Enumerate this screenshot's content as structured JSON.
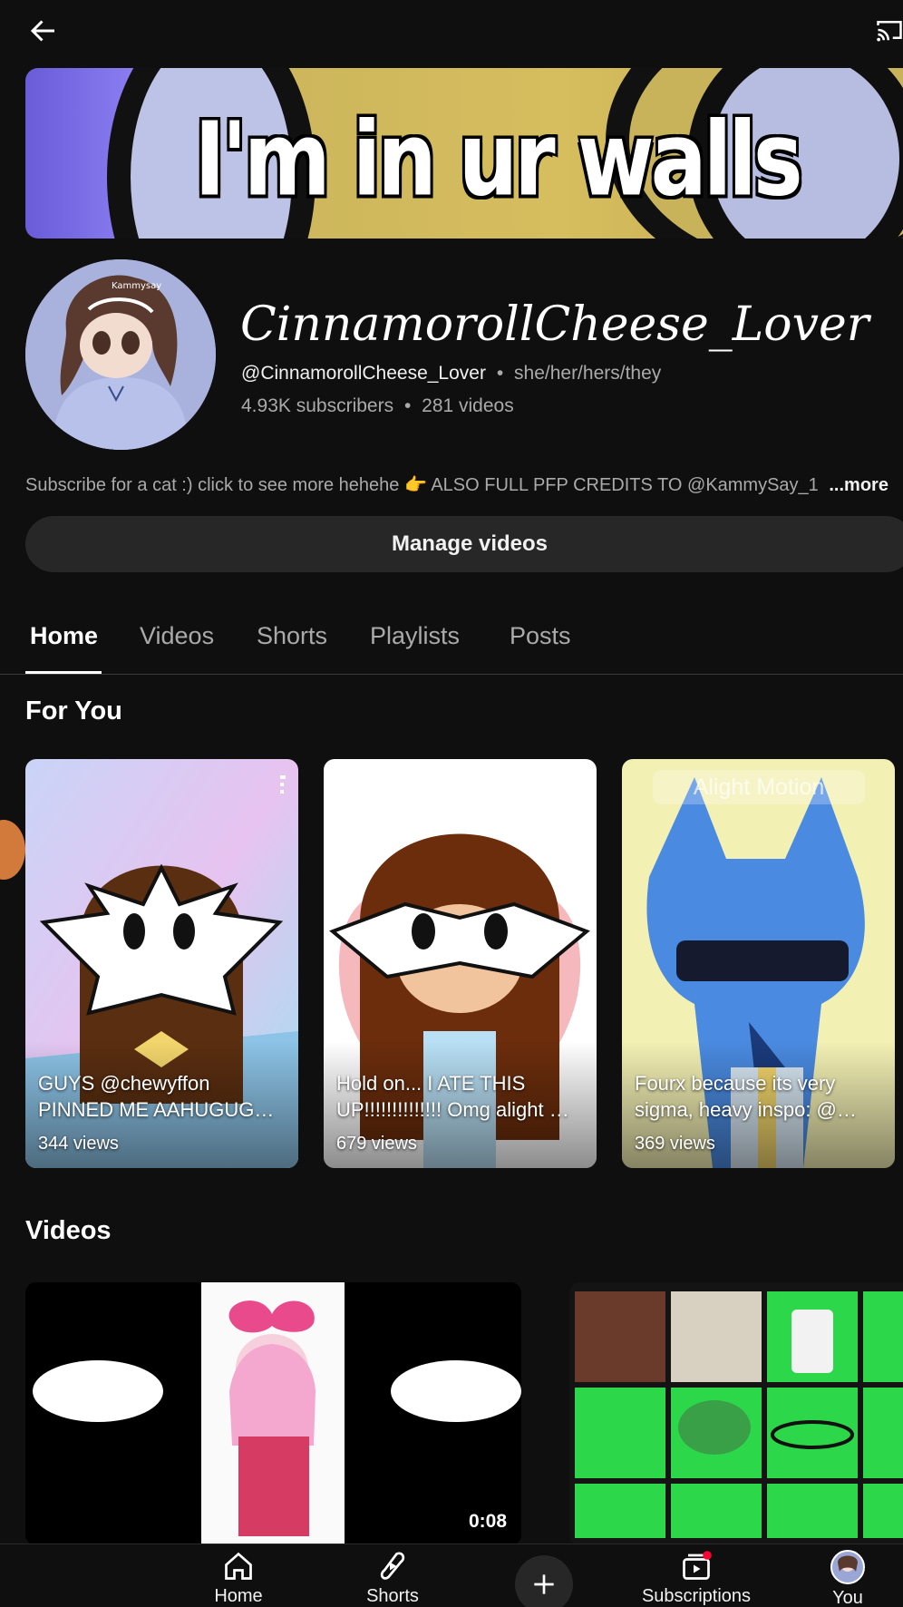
{
  "topbar": {
    "back_icon": "arrow-left-icon",
    "cast_icon": "cast-icon"
  },
  "banner": {
    "text": "I'm in ur walls"
  },
  "channel": {
    "name": "CinnamorollCheese_Lover",
    "handle": "@CinnamorollCheese_Lover",
    "separator": "•",
    "pronouns": "she/her/hers/they",
    "subscribers": "4.93K subscribers",
    "videos_count": "281 videos",
    "description": "Subscribe for a cat :) click to see more hehehe 👉 ALSO FULL PFP CREDITS TO @KammySay_1",
    "more_label": "...more",
    "avatar_text": "Kammysay"
  },
  "manage_button": {
    "label": "Manage videos"
  },
  "tabs": [
    {
      "label": "Home",
      "active": true
    },
    {
      "label": "Videos",
      "active": false
    },
    {
      "label": "Shorts",
      "active": false
    },
    {
      "label": "Playlists",
      "active": false
    },
    {
      "label": "Posts",
      "active": false
    }
  ],
  "for_you": {
    "title": "For You",
    "shorts": [
      {
        "title": "GUYS @chewyffon PINNED ME AAHUGUG…",
        "views": "344 views"
      },
      {
        "title": "Hold on... I ATE THIS UP!!!!!!!!!!!!!! Omg alight …",
        "views": "679 views"
      },
      {
        "title": "Fourx because its very sigma, heavy inspo: @…",
        "views": "369 views",
        "watermark": "Alight Motion"
      }
    ]
  },
  "videos": {
    "title": "Videos",
    "items": [
      {
        "duration": "0:08"
      },
      {
        "duration": ""
      }
    ]
  },
  "bottom_nav": {
    "items": [
      {
        "label": "Home",
        "icon": "home-icon"
      },
      {
        "label": "Shorts",
        "icon": "shorts-icon"
      },
      {
        "label": "Subscriptions",
        "icon": "subscriptions-icon"
      },
      {
        "label": "You",
        "icon": "avatar"
      }
    ],
    "create_icon": "plus-icon"
  },
  "colors": {
    "background": "#0f0f0f",
    "button": "#272727",
    "text_secondary": "#aaaaaa",
    "notification": "#ff0033"
  }
}
